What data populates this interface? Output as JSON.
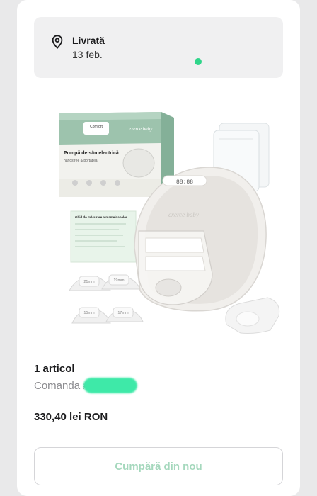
{
  "delivery": {
    "status": "Livrată",
    "date": "13 feb."
  },
  "product": {
    "box_brand": "exerce baby",
    "box_series": "Comfort",
    "box_title": "Pompă de sân electrică",
    "box_subtitle": "handsfree & portabilă",
    "insert_title": "Ghid de măsurare a mameloanelor",
    "flange_sizes": [
      "21mm",
      "19mm",
      "15mm",
      "17mm"
    ],
    "pump_display": "88:88"
  },
  "order": {
    "items_count": "1 articol",
    "order_label": "Comanda #",
    "price": "330,40 lei RON"
  },
  "actions": {
    "buy_again_label": "Cumpără din nou"
  },
  "colors": {
    "accent": "#2fd58a",
    "button_text": "#a5d8bd",
    "box_green": "#9dc3ad"
  }
}
